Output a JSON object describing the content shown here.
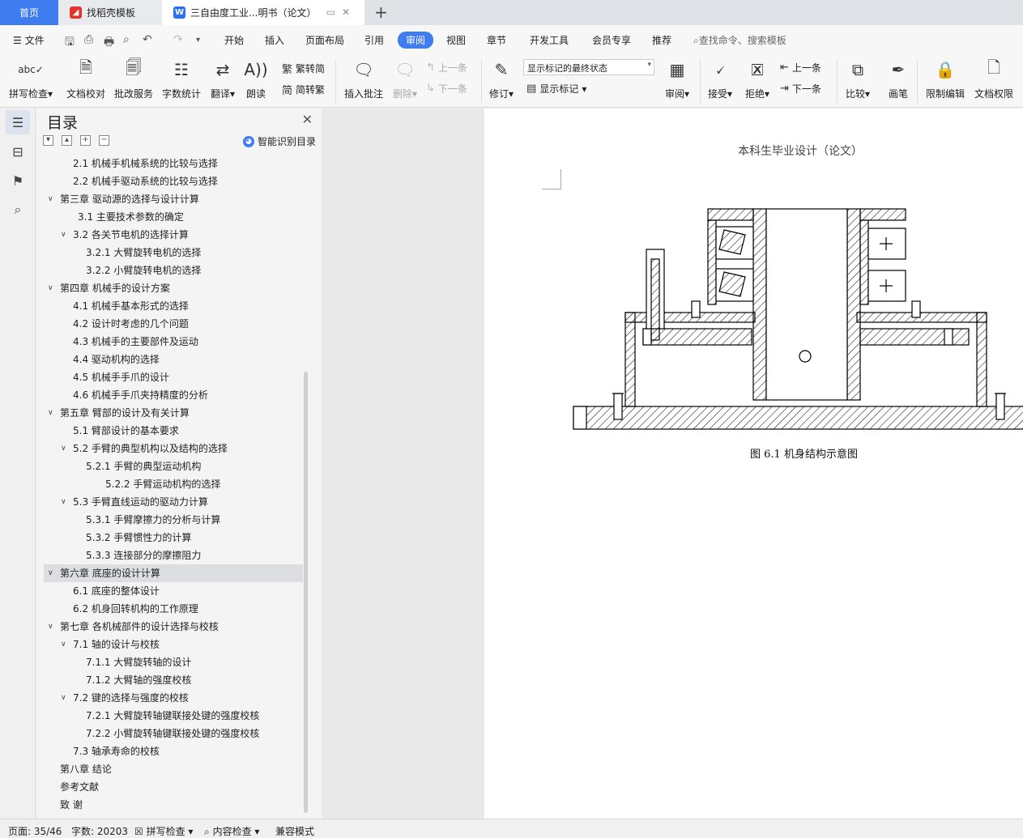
{
  "tabs": {
    "home": "首页",
    "template": "找稻壳模板",
    "document": "三自由度工业...明书（论文）"
  },
  "menu": {
    "file": "文件",
    "items": [
      "开始",
      "插入",
      "页面布局",
      "引用",
      "审阅",
      "视图",
      "章节",
      "开发工具",
      "会员专享",
      "推荐"
    ],
    "active": "审阅",
    "search_placeholder": "查找命令、搜索模板"
  },
  "ribbon": {
    "spell_check": "拼写检查",
    "doc_proof": "文档校对",
    "proof_service": "批改服务",
    "word_count": "字数统计",
    "translate": "翻译",
    "read_aloud": "朗读",
    "trad_convert": "繁转简",
    "simp_convert": "简转繁",
    "insert_comment": "插入批注",
    "delete": "删除",
    "prev_comment": "上一条",
    "next_comment": "下一条",
    "track_changes": "修订",
    "markup_state": "显示标记的最终状态",
    "show_markup": "显示标记",
    "review": "审阅",
    "accept": "接受",
    "reject": "拒绝",
    "prev_change": "上一条",
    "next_change": "下一条",
    "compare": "比较",
    "ink": "画笔",
    "restrict_edit": "限制编辑",
    "doc_permission": "文档权限"
  },
  "toc": {
    "title": "目录",
    "smart_label": "智能识别目录",
    "items": [
      {
        "label": "2.1   机械手机械系统的比较与选择",
        "level": 2,
        "arrow": false
      },
      {
        "label": "2.2   机械手驱动系统的比较与选择",
        "level": 2,
        "arrow": false
      },
      {
        "label": "第三章   驱动源的选择与设计计算",
        "level": 1,
        "arrow": true
      },
      {
        "label": "3.1   主要技术参数的确定",
        "level": 2.4,
        "arrow": false
      },
      {
        "label": "3.2   各关节电机的选择计算",
        "level": 2,
        "arrow": true
      },
      {
        "label": "3.2.1   大臂旋转电机的选择",
        "level": 3,
        "arrow": false
      },
      {
        "label": "3.2.2   小臂旋转电机的选择",
        "level": 3,
        "arrow": false
      },
      {
        "label": "第四章   机械手的设计方案",
        "level": 1,
        "arrow": true
      },
      {
        "label": "4.1  机械手基本形式的选择",
        "level": 2,
        "arrow": false
      },
      {
        "label": "4.2   设计时考虑的几个问题",
        "level": 2,
        "arrow": false
      },
      {
        "label": "4.3 机械手的主要部件及运动",
        "level": 2,
        "arrow": false
      },
      {
        "label": "4.4 驱动机构的选择",
        "level": 2,
        "arrow": false
      },
      {
        "label": "4.5 机械手手爪的设计",
        "level": 2,
        "arrow": false
      },
      {
        "label": "4.6  机械手手爪夹持精度的分析",
        "level": 2,
        "arrow": false
      },
      {
        "label": "第五章   臂部的设计及有关计算",
        "level": 1,
        "arrow": true
      },
      {
        "label": "5.1  臂部设计的基本要求",
        "level": 2,
        "arrow": false
      },
      {
        "label": "5.2  手臂的典型机构以及结构的选择",
        "level": 2,
        "arrow": true
      },
      {
        "label": "5.2.1  手臂的典型运动机构",
        "level": 3,
        "arrow": false
      },
      {
        "label": "5.2.2  手臂运动机构的选择",
        "level": 4,
        "arrow": false
      },
      {
        "label": "5.3  手臂直线运动的驱动力计算",
        "level": 2,
        "arrow": true
      },
      {
        "label": "5.3.1  手臂摩擦力的分析与计算",
        "level": 3,
        "arrow": false
      },
      {
        "label": "5.3.2  手臂惯性力的计算",
        "level": 3,
        "arrow": false
      },
      {
        "label": "5.3.3 连接部分的摩擦阻力",
        "level": 3,
        "arrow": false
      },
      {
        "label": "第六章   底座的设计计算",
        "level": 1,
        "arrow": true,
        "selected": true
      },
      {
        "label": "6.1  底座的整体设计",
        "level": 2,
        "arrow": false
      },
      {
        "label": "6.2  机身回转机构的工作原理",
        "level": 2,
        "arrow": false
      },
      {
        "label": "第七章   各机械部件的设计选择与校核",
        "level": 1,
        "arrow": true
      },
      {
        "label": "7.1    轴的设计与校核",
        "level": 2,
        "arrow": true
      },
      {
        "label": "7.1.1    大臂旋转轴的设计",
        "level": 3,
        "arrow": false
      },
      {
        "label": "7.1.2    大臂轴的强度校核",
        "level": 3,
        "arrow": false
      },
      {
        "label": "7.2    键的选择与强度的校核",
        "level": 2,
        "arrow": true
      },
      {
        "label": "7.2.1 大臂旋转轴键联接处键的强度校核",
        "level": 3,
        "arrow": false
      },
      {
        "label": "7.2.2 小臂旋转轴键联接处键的强度校核",
        "level": 3,
        "arrow": false
      },
      {
        "label": "7.3    轴承寿命的校核",
        "level": 2,
        "arrow": false
      },
      {
        "label": "第八章    结论",
        "level": 1,
        "arrow": false
      },
      {
        "label": "参考文献",
        "level": 1,
        "arrow": false
      },
      {
        "label": "致  谢",
        "level": 1,
        "arrow": false
      }
    ]
  },
  "document": {
    "header": "本科生毕业设计（论文）",
    "caption": "图 6.1 机身结构示意图"
  },
  "status": {
    "page": "页面: 35/46",
    "words": "字数: 20203",
    "spell": "拼写检查",
    "content_check": "内容检查",
    "compat": "兼容模式"
  }
}
